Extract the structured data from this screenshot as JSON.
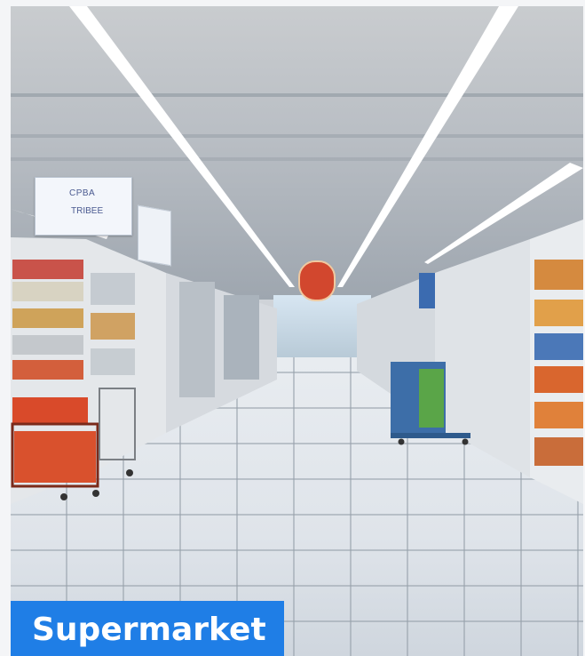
{
  "caption": "Supermarket",
  "store_sign": {
    "line1": "CPBA",
    "line2": "TRIBEE"
  },
  "colors": {
    "caption_bg": "#1f7ee6",
    "caption_text": "#ffffff",
    "accent_red": "#d2472e"
  }
}
